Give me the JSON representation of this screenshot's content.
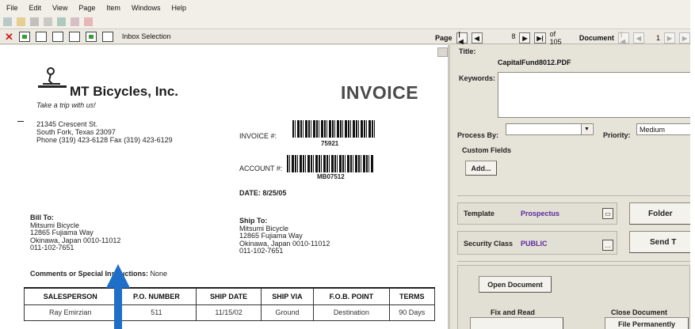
{
  "menu": [
    "File",
    "Edit",
    "View",
    "Page",
    "Item",
    "Windows",
    "Help"
  ],
  "toolbar": {
    "inbox_selection": "Inbox Selection"
  },
  "pager": {
    "page_label": "Page",
    "page_first": "|◀",
    "page_prev": "◀",
    "page_number": "8",
    "page_next": "▶",
    "page_last": "▶|",
    "page_total": "of 105",
    "document_label": "Document",
    "doc_first": "|◀",
    "doc_prev": "◀",
    "doc_number": "1",
    "doc_next": "▶",
    "doc_last": "▶"
  },
  "invoice": {
    "company": "MT Bicycles, Inc.",
    "tagline": "Take a trip with us!",
    "address_lines": [
      "21345 Crescent St.",
      "South Fork, Texas 23097",
      "Phone (319) 423-6128  Fax (319) 423-6129"
    ],
    "title": "INVOICE",
    "invoice_label": "INVOICE #:",
    "invoice_number": "75921",
    "account_label": "ACCOUNT #:",
    "account_number": "MB07512",
    "date": "DATE: 8/25/05",
    "bill_to": {
      "heading": "Bill To:",
      "lines": [
        "Mitsumi Bicycle",
        "12865 Fujiama Way",
        "Okinawa, Japan 0010-11012",
        "011-102-7651"
      ]
    },
    "ship_to": {
      "heading": "Ship To:",
      "lines": [
        "Mitsumi Bicycle",
        "12865 Fujiama Way",
        "Okinawa, Japan 0010-11012",
        "011-102-7651"
      ]
    },
    "comments_label": "Comments or Special Instructions:",
    "comments_value": "None",
    "table": {
      "headers": [
        "SALESPERSON",
        "P.O. NUMBER",
        "SHIP DATE",
        "SHIP VIA",
        "F.O.B. POINT",
        "TERMS"
      ],
      "row": [
        "Ray Emirzian",
        "511",
        "11/15/02",
        "Ground",
        "Destination",
        "90 Days"
      ]
    }
  },
  "panel": {
    "title_label": "Title:",
    "title_value": "CapitalFund8012.PDF",
    "keywords_label": "Keywords:",
    "keywords_value": "",
    "process_by_label": "Process By:",
    "process_by_value": "",
    "priority_label": "Priority:",
    "priority_value": "Medium",
    "custom_fields_label": "Custom Fields",
    "add_button": "Add...",
    "template_label": "Template",
    "template_value": "Prospectus",
    "folder_button": "Folder",
    "security_label": "Security Class",
    "security_value": "PUBLIC",
    "send_button": "Send T",
    "open_document": "Open Document",
    "fix_and_read": "Fix and Read",
    "close_document": "Close Document",
    "file_permanently": "File Permanently"
  },
  "colors": {
    "accent_purple": "#5a2aa0",
    "arrow_blue": "#1f6fc8",
    "close_red": "#d01c1c"
  }
}
